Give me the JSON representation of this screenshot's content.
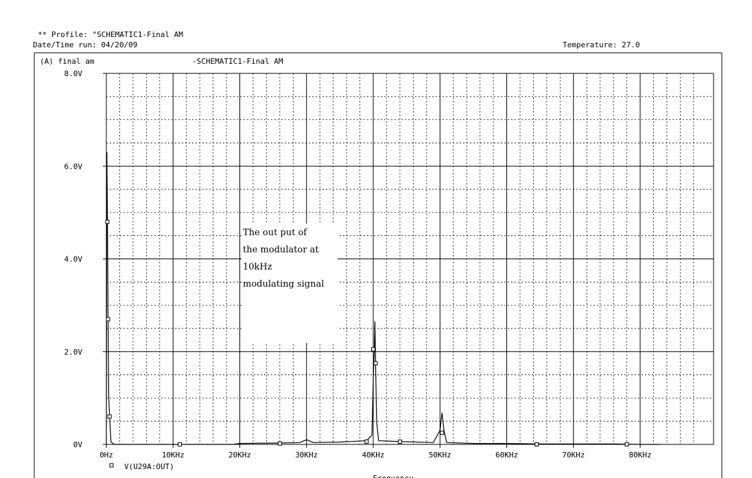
{
  "header": {
    "profile_line": "** Profile: \"SCHEMATIC1-Final AM",
    "datetime_line": "Date/Time run: 04/20/09",
    "temperature": "Temperature: 27.0"
  },
  "panel": {
    "label": "(A) final am",
    "title": "-SCHEMATIC1-Final AM"
  },
  "annotation": {
    "lines": [
      "The out put of",
      "the modulator at",
      "10kHz",
      "modulating signal"
    ]
  },
  "chart_data": {
    "type": "line",
    "title": "-SCHEMATIC1-Final AM",
    "xlabel": "Frequency",
    "ylabel": "",
    "xlim": [
      0,
      91000
    ],
    "ylim": [
      0,
      8
    ],
    "x_ticks": [
      0,
      10000,
      20000,
      30000,
      40000,
      50000,
      60000,
      70000,
      80000
    ],
    "x_tick_labels": [
      "0Hz",
      "10KHz",
      "20KHz",
      "30KHz",
      "40KHz",
      "50KHz",
      "60KHz",
      "70KHz",
      "80KHz"
    ],
    "y_ticks": [
      0,
      2,
      4,
      6,
      8
    ],
    "y_tick_labels": [
      "0V",
      "2.0V",
      "4.0V",
      "6.0V",
      "8.0V"
    ],
    "grid": true,
    "series": [
      {
        "name": "V(U29A:OUT)",
        "color": "#000000",
        "marker": "square",
        "points": [
          [
            0,
            0.0
          ],
          [
            80,
            6.3
          ],
          [
            160,
            4.8
          ],
          [
            260,
            2.7
          ],
          [
            360,
            1.0
          ],
          [
            480,
            0.6
          ],
          [
            700,
            0.05
          ],
          [
            1200,
            0.0
          ],
          [
            11000,
            0.0
          ],
          [
            19000,
            0.0
          ],
          [
            20000,
            0.02
          ],
          [
            26000,
            0.03
          ],
          [
            29000,
            0.04
          ],
          [
            30000,
            0.1
          ],
          [
            31000,
            0.04
          ],
          [
            35000,
            0.05
          ],
          [
            39000,
            0.08
          ],
          [
            39800,
            0.2
          ],
          [
            40000,
            1.4
          ],
          [
            40150,
            2.05
          ],
          [
            40250,
            2.65
          ],
          [
            40350,
            1.75
          ],
          [
            40500,
            0.5
          ],
          [
            40800,
            0.08
          ],
          [
            44000,
            0.06
          ],
          [
            49000,
            0.04
          ],
          [
            50000,
            0.3
          ],
          [
            50300,
            0.68
          ],
          [
            50600,
            0.3
          ],
          [
            51000,
            0.04
          ],
          [
            55000,
            0.02
          ],
          [
            60000,
            0.02
          ],
          [
            64500,
            0.01
          ],
          [
            70000,
            0.01
          ],
          [
            76000,
            0.01
          ],
          [
            80000,
            0.0
          ],
          [
            83000,
            0.0
          ]
        ],
        "marker_points": [
          [
            150,
            4.8
          ],
          [
            260,
            2.7
          ],
          [
            480,
            0.6
          ],
          [
            11000,
            0.0
          ],
          [
            26000,
            0.02
          ],
          [
            39000,
            0.06
          ],
          [
            40000,
            2.05
          ],
          [
            40350,
            1.75
          ],
          [
            44000,
            0.06
          ],
          [
            50300,
            0.25
          ],
          [
            64500,
            0.0
          ],
          [
            78000,
            0.0
          ]
        ]
      }
    ]
  }
}
